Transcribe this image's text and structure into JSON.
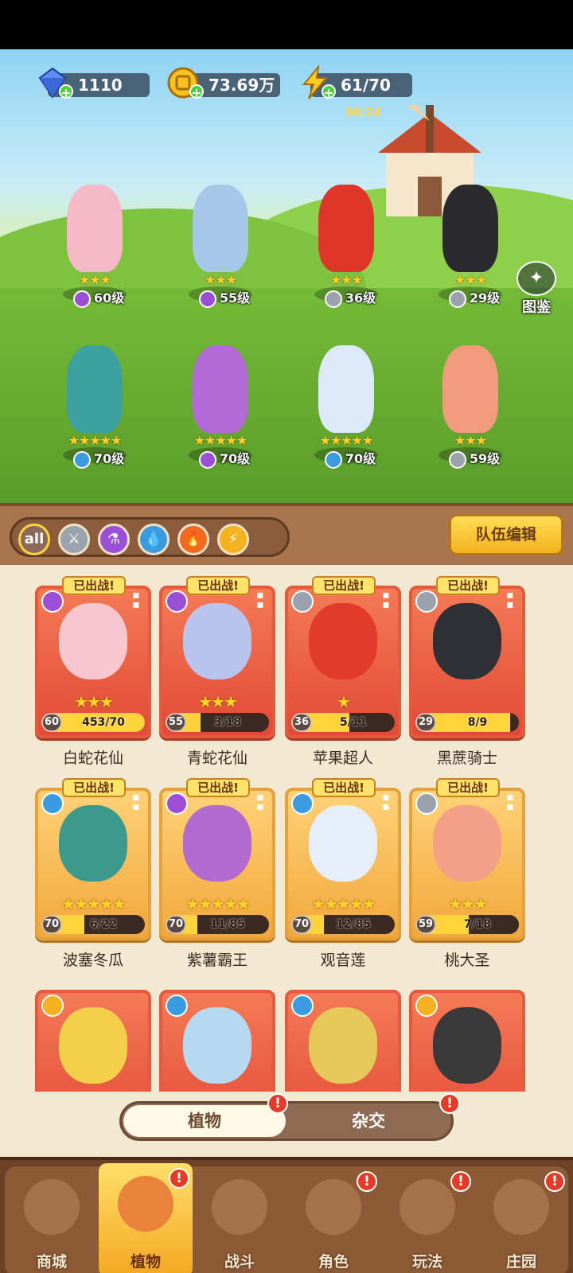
{
  "resources": {
    "gems": "1110",
    "gold": "73.69万",
    "energy": "61/70",
    "energy_timer": "00:24"
  },
  "album": {
    "label": "图鉴"
  },
  "roster": [
    {
      "level": "60级",
      "stars": "★★★",
      "element": "purple"
    },
    {
      "level": "55级",
      "stars": "★★★",
      "element": "purple"
    },
    {
      "level": "36级",
      "stars": "★★★",
      "element": "sword"
    },
    {
      "level": "29级",
      "stars": "★★★",
      "element": "sword"
    },
    {
      "level": "70级",
      "stars": "★★★★★",
      "element": "water"
    },
    {
      "level": "70级",
      "stars": "★★★★★",
      "element": "purple"
    },
    {
      "level": "70级",
      "stars": "★★★★★",
      "element": "water"
    },
    {
      "level": "59级",
      "stars": "★★★",
      "element": "sword"
    }
  ],
  "filters": {
    "all": "all"
  },
  "team_edit": "队伍编辑",
  "deployed_badge": "已出战!",
  "cards": [
    {
      "name": "白蛇花仙",
      "level": "60",
      "count": "453/70",
      "progress": 1.0,
      "stars": "★★★",
      "style": "red",
      "element": "purple"
    },
    {
      "name": "青蛇花仙",
      "level": "55",
      "count": "3/18",
      "progress": 0.17,
      "stars": "★★★",
      "style": "red",
      "element": "purple"
    },
    {
      "name": "苹果超人",
      "level": "36",
      "count": "5/11",
      "progress": 0.45,
      "stars": "★",
      "style": "red",
      "element": "sword"
    },
    {
      "name": "黑蔗骑士",
      "level": "29",
      "count": "8/9",
      "progress": 0.89,
      "stars": "",
      "style": "red",
      "element": "sword"
    },
    {
      "name": "波塞冬瓜",
      "level": "70",
      "count": "6/22",
      "progress": 0.27,
      "stars": "★★★★★",
      "style": "gold",
      "element": "water"
    },
    {
      "name": "紫薯霸王",
      "level": "70",
      "count": "11/85",
      "progress": 0.13,
      "stars": "★★★★★",
      "style": "gold",
      "element": "purple"
    },
    {
      "name": "观音莲",
      "level": "70",
      "count": "12/85",
      "progress": 0.14,
      "stars": "★★★★★",
      "style": "gold",
      "element": "water"
    },
    {
      "name": "桃大圣",
      "level": "59",
      "count": "7/18",
      "progress": 0.39,
      "stars": "★★★",
      "style": "gold",
      "element": "sword"
    }
  ],
  "tabs": {
    "plants": "植物",
    "hybrid": "杂交"
  },
  "nav": [
    {
      "label": "商城",
      "alert": false
    },
    {
      "label": "植物",
      "alert": true,
      "active": true
    },
    {
      "label": "战斗",
      "alert": false
    },
    {
      "label": "角色",
      "alert": true
    },
    {
      "label": "玩法",
      "alert": true
    },
    {
      "label": "庄园",
      "alert": true
    }
  ],
  "colors": {
    "purple": "#9b4fd6",
    "water": "#3a9be0",
    "sword": "#9aa3ad",
    "fire": "#ef6a1f",
    "bolt": "#f3b21e"
  }
}
